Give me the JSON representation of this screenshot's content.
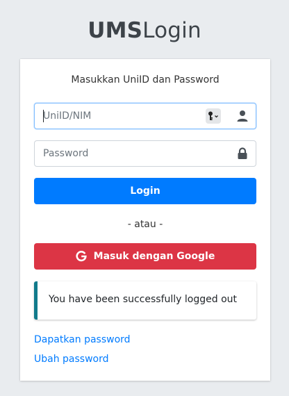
{
  "logo": {
    "bold": "UMS",
    "light": "Login"
  },
  "form": {
    "message": "Masukkan UniID dan Password",
    "username_placeholder": "UniID/NIM",
    "password_placeholder": "Password",
    "login_label": "Login",
    "separator": "- atau -",
    "google_label": "Masuk dengan Google"
  },
  "alert": {
    "text": "You have been successfully logged out",
    "accent_color": "#117a8b"
  },
  "links": {
    "get_password": "Dapatkan password",
    "change_password": "Ubah password"
  },
  "colors": {
    "primary": "#007bff",
    "danger": "#dc3545",
    "background": "#e9ecef"
  },
  "icons": {
    "key": "key-icon",
    "user": "user-icon",
    "lock": "lock-icon",
    "google": "google-icon"
  }
}
